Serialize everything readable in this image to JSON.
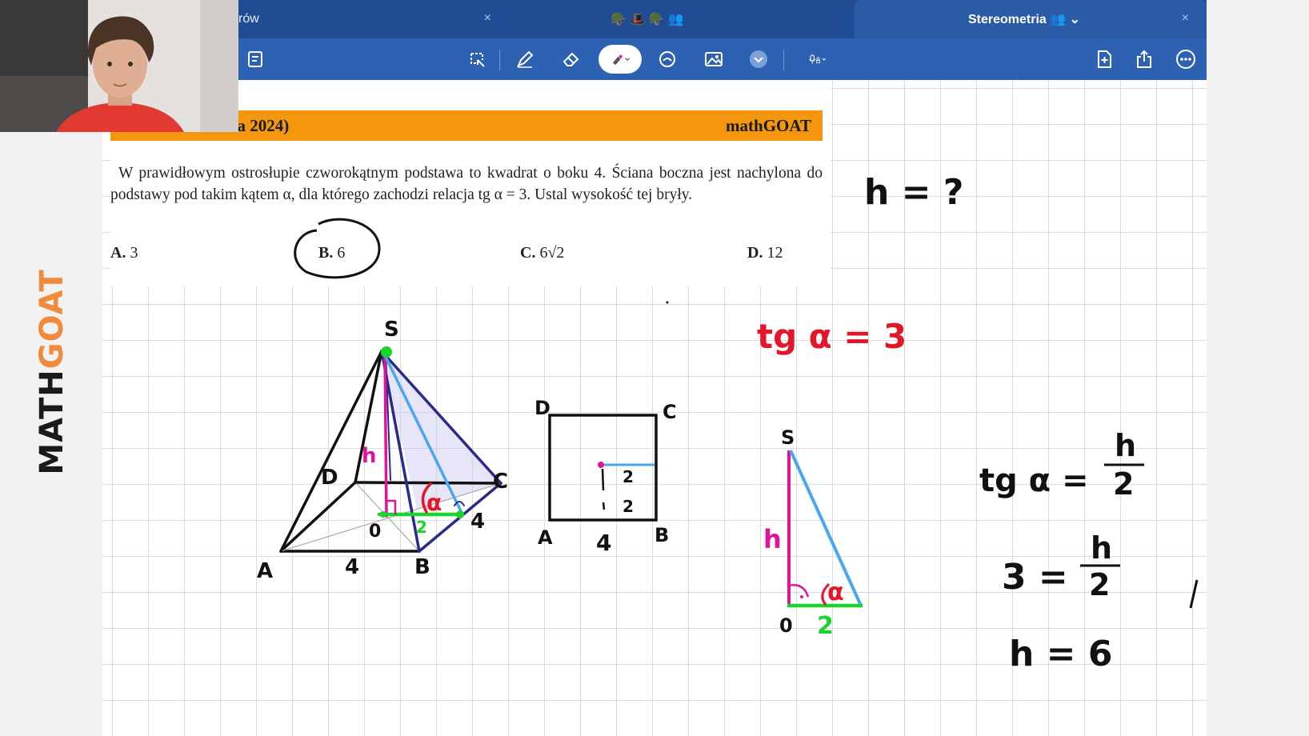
{
  "tabs": [
    {
      "title": "rów",
      "close": "×"
    },
    {
      "title": "🪖🎩🪖👥",
      "close": "×"
    },
    {
      "title": "Stereometria 👥 ⌄",
      "close": "×",
      "active": true
    }
  ],
  "toolbar": {
    "tools": [
      "lasso-icon",
      "pen-icon",
      "eraser-icon",
      "highlighter-icon",
      "shapes-icon",
      "image-icon",
      "more-tools-icon",
      "mic-icon"
    ],
    "right_tools": [
      "add-page-icon",
      "share-icon",
      "more-icon"
    ],
    "colors": {
      "bar": "#2d62b3",
      "tabbar": "#1f4c93",
      "active_tab": "#2a5ba7"
    }
  },
  "task": {
    "header_left": "atura 2024)",
    "header_right": "mathGOAT",
    "header_color": "#f5960f",
    "problem": "W prawidłowym ostrosłupie czworokątnym podstawa to kwadrat o boku 4. Ściana boczna jest nachylona do podstawy pod takim kątem α, dla którego zachodzi relacja tg α = 3. Ustal wysokość tej bryły.",
    "options": [
      {
        "letter": "A.",
        "value": "3"
      },
      {
        "letter": "B.",
        "value": "6",
        "circled": true
      },
      {
        "letter": "C.",
        "value": "6√2"
      },
      {
        "letter": "D.",
        "value": "12"
      }
    ]
  },
  "notes": {
    "question": "h = ?",
    "given": "tg α = 3",
    "pyramid_labels": {
      "apex": "S",
      "a": "A",
      "b": "B",
      "c": "C",
      "d": "D",
      "o": "0",
      "h": "h",
      "alpha": "α",
      "half": "2",
      "side_bottom": "4",
      "side_right": "4"
    },
    "square_labels": {
      "a": "A",
      "b": "B",
      "c": "C",
      "d": "D",
      "side": "4",
      "half_top": "2",
      "half_bottom": "2"
    },
    "triangle_labels": {
      "s": "S",
      "o": "0",
      "h": "h",
      "alpha": "α",
      "base": "2"
    },
    "eq1_left": "tg α =",
    "eq1_num": "h",
    "eq1_den": "2",
    "eq2_left": "3 =",
    "eq2_num": "h",
    "eq2_den": "2",
    "eq3": "h = 6",
    "ink_colors": {
      "black": "#111111",
      "magenta": "#e0139a",
      "green": "#19d42a",
      "blue": "#4aa6ef",
      "navy": "#2a2a8a",
      "red": "#e3162a"
    }
  },
  "logo": {
    "part1": "MATH",
    "part2": "GOAT"
  }
}
